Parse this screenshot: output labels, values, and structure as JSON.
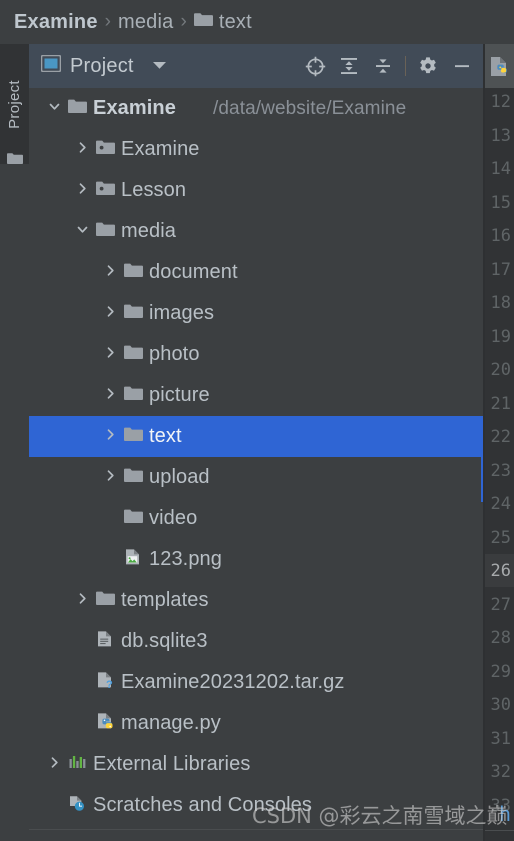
{
  "breadcrumb": {
    "name": "breadcrumb",
    "separator": "›",
    "items": [
      {
        "label": "Examine",
        "bold": true,
        "icon": ""
      },
      {
        "label": "media",
        "bold": false,
        "icon": ""
      },
      {
        "label": "text",
        "bold": false,
        "icon": "folder-icon"
      }
    ]
  },
  "left_strip": {
    "tab_label": "Project",
    "tab_icon": "folder-icon"
  },
  "project_header": {
    "icon": "project-view-icon",
    "title": "Project",
    "dropdown_icon": "chevron-down-icon",
    "actions": [
      {
        "name": "select-opened-file-button",
        "icon": "crosshair-target-icon"
      },
      {
        "name": "expand-all-button",
        "icon": "expand-all-icon"
      },
      {
        "name": "collapse-all-button",
        "icon": "collapse-all-icon"
      },
      {
        "name": "settings-button",
        "icon": "gear-icon"
      },
      {
        "name": "hide-panel-button",
        "icon": "minimize-icon"
      }
    ]
  },
  "tree": {
    "rows": [
      {
        "label": "Examine",
        "path": "/data/website/Examine",
        "icon": "folder-icon",
        "arrow": "expanded",
        "depth": 0,
        "bold": true,
        "selected": false
      },
      {
        "label": "Examine",
        "path": "",
        "icon": "module-folder-icon",
        "arrow": "collapsed",
        "depth": 1,
        "bold": false,
        "selected": false
      },
      {
        "label": "Lesson",
        "path": "",
        "icon": "module-folder-icon",
        "arrow": "collapsed",
        "depth": 1,
        "bold": false,
        "selected": false
      },
      {
        "label": "media",
        "path": "",
        "icon": "folder-icon",
        "arrow": "expanded",
        "depth": 1,
        "bold": false,
        "selected": false
      },
      {
        "label": "document",
        "path": "",
        "icon": "folder-icon",
        "arrow": "collapsed",
        "depth": 2,
        "bold": false,
        "selected": false
      },
      {
        "label": "images",
        "path": "",
        "icon": "folder-icon",
        "arrow": "collapsed",
        "depth": 2,
        "bold": false,
        "selected": false
      },
      {
        "label": "photo",
        "path": "",
        "icon": "folder-icon",
        "arrow": "collapsed",
        "depth": 2,
        "bold": false,
        "selected": false
      },
      {
        "label": "picture",
        "path": "",
        "icon": "folder-icon",
        "arrow": "collapsed",
        "depth": 2,
        "bold": false,
        "selected": false
      },
      {
        "label": "text",
        "path": "",
        "icon": "folder-icon",
        "arrow": "collapsed",
        "depth": 2,
        "bold": false,
        "selected": true
      },
      {
        "label": "upload",
        "path": "",
        "icon": "folder-icon",
        "arrow": "collapsed",
        "depth": 2,
        "bold": false,
        "selected": false
      },
      {
        "label": "video",
        "path": "",
        "icon": "folder-icon",
        "arrow": "none",
        "depth": 2,
        "bold": false,
        "selected": false
      },
      {
        "label": "123.png",
        "path": "",
        "icon": "image-file-icon",
        "arrow": "none",
        "depth": 2,
        "bold": false,
        "selected": false
      },
      {
        "label": "templates",
        "path": "",
        "icon": "folder-icon",
        "arrow": "collapsed",
        "depth": 1,
        "bold": false,
        "selected": false
      },
      {
        "label": "db.sqlite3",
        "path": "",
        "icon": "text-file-icon",
        "arrow": "none",
        "depth": 1,
        "bold": false,
        "selected": false
      },
      {
        "label": "Examine20231202.tar.gz",
        "path": "",
        "icon": "unknown-file-icon",
        "arrow": "none",
        "depth": 1,
        "bold": false,
        "selected": false
      },
      {
        "label": "manage.py",
        "path": "",
        "icon": "python-file-icon",
        "arrow": "none",
        "depth": 1,
        "bold": false,
        "selected": false
      },
      {
        "label": "External Libraries",
        "path": "",
        "icon": "libraries-icon",
        "arrow": "collapsed",
        "depth": 0,
        "bold": false,
        "selected": false
      },
      {
        "label": "Scratches and Consoles",
        "path": "",
        "icon": "scratches-icon",
        "arrow": "none",
        "depth": 0,
        "bold": false,
        "selected": false
      }
    ]
  },
  "editor": {
    "tab_icon": "python-file-icon",
    "line_numbers": [
      "12",
      "13",
      "14",
      "15",
      "16",
      "17",
      "18",
      "19",
      "20",
      "21",
      "22",
      "23",
      "24",
      "25",
      "26",
      "27",
      "28",
      "29",
      "30",
      "31",
      "32",
      "33"
    ],
    "current_line": "26",
    "visible_char": "h"
  },
  "watermark": {
    "text": "CSDN @彩云之南雪域之巅"
  },
  "colors": {
    "selection": "#2f65d4",
    "panel_bg": "#3c3f41",
    "header_bg": "#414b57",
    "gutter_bg": "#313335",
    "text": "#b9c0c6",
    "text_dim": "#8a9097",
    "folder_icon": "#9aa0a6",
    "python_blue": "#4b8bbe",
    "python_yellow": "#ffd43b",
    "libraries_green": "#62b543"
  }
}
